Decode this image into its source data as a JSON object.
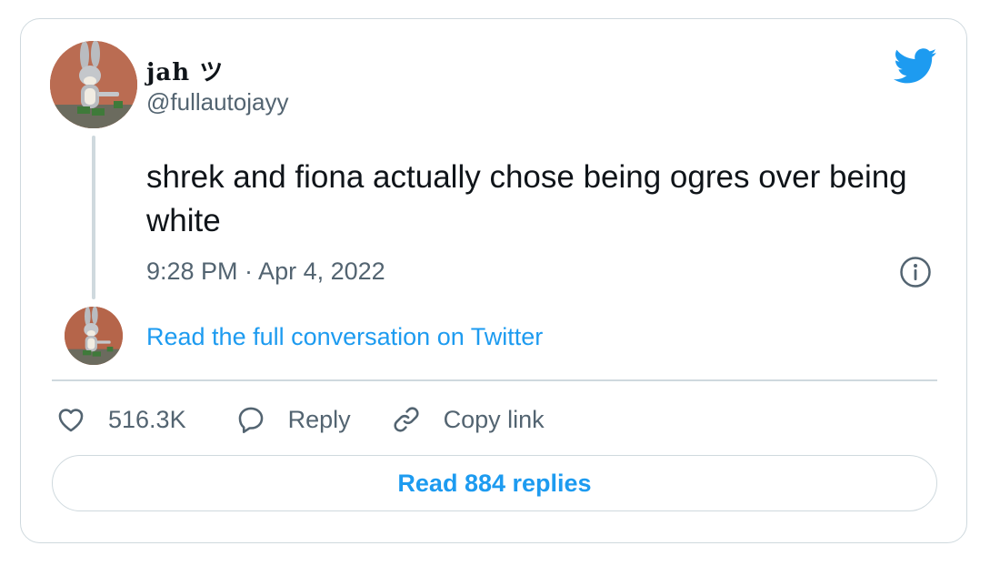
{
  "user": {
    "display_name": "jah ツ",
    "handle": "@fullautojayy",
    "avatar_icon": "bugs-bunny-avatar"
  },
  "tweet": {
    "text": "shrek and fiona actually chose being ogres over being white",
    "timestamp": "9:28 PM · Apr 4, 2022"
  },
  "thread": {
    "read_conversation_label": "Read the full conversation on Twitter"
  },
  "actions": {
    "like_count": "516.3K",
    "reply_label": "Reply",
    "copy_link_label": "Copy link"
  },
  "read_replies_label": "Read 884 replies",
  "colors": {
    "accent": "#1d9bf0",
    "secondary_text": "#536471",
    "border": "#cfd9de"
  },
  "icons": {
    "brand": "twitter-bird-icon",
    "info": "info-icon",
    "like": "heart-icon",
    "reply": "speech-bubble-icon",
    "copy_link": "link-icon"
  }
}
